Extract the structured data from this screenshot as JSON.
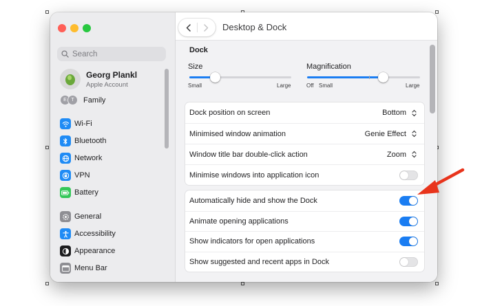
{
  "colors": {
    "accent": "#1a7df2",
    "annotation_arrow": "#e8341c"
  },
  "sidebar": {
    "search_placeholder": "Search",
    "profile": {
      "name": "Georg Plankl",
      "subtitle": "Apple Account"
    },
    "family": {
      "label": "Family",
      "initials": [
        "E",
        "T"
      ]
    },
    "items": [
      {
        "label": "Wi-Fi",
        "icon": "wifi-icon",
        "color": "#1f8bf5"
      },
      {
        "label": "Bluetooth",
        "icon": "bluetooth-icon",
        "color": "#1f8bf5"
      },
      {
        "label": "Network",
        "icon": "globe-icon",
        "color": "#1f8bf5"
      },
      {
        "label": "VPN",
        "icon": "vpn-icon",
        "color": "#1f8bf5"
      },
      {
        "label": "Battery",
        "icon": "battery-icon",
        "color": "#34c759"
      },
      {
        "label": "General",
        "icon": "gear-icon",
        "color": "#8e8e93"
      },
      {
        "label": "Accessibility",
        "icon": "accessibility-icon",
        "color": "#1f8bf5"
      },
      {
        "label": "Appearance",
        "icon": "appearance-icon",
        "color": "#1d1d1f"
      },
      {
        "label": "Menu Bar",
        "icon": "menu-bar-icon",
        "color": "#8e8e93"
      }
    ]
  },
  "header": {
    "title": "Desktop & Dock"
  },
  "dock": {
    "section_title": "Dock",
    "size": {
      "label": "Size",
      "min_label": "Small",
      "max_label": "Large",
      "value": 0.25
    },
    "magnification": {
      "label": "Magnification",
      "off_label": "Off",
      "min_label": "Small",
      "max_label": "Large",
      "value": 0.67
    },
    "settings": [
      {
        "label": "Dock position on screen",
        "value": "Bottom"
      },
      {
        "label": "Minimised window animation",
        "value": "Genie Effect"
      },
      {
        "label": "Window title bar double-click action",
        "value": "Zoom"
      },
      {
        "label": "Minimise windows into application icon",
        "on": false
      }
    ],
    "toggles": [
      {
        "label": "Automatically hide and show the Dock",
        "on": true
      },
      {
        "label": "Animate opening applications",
        "on": true
      },
      {
        "label": "Show indicators for open applications",
        "on": true
      },
      {
        "label": "Show suggested and recent apps in Dock",
        "on": false
      }
    ]
  }
}
